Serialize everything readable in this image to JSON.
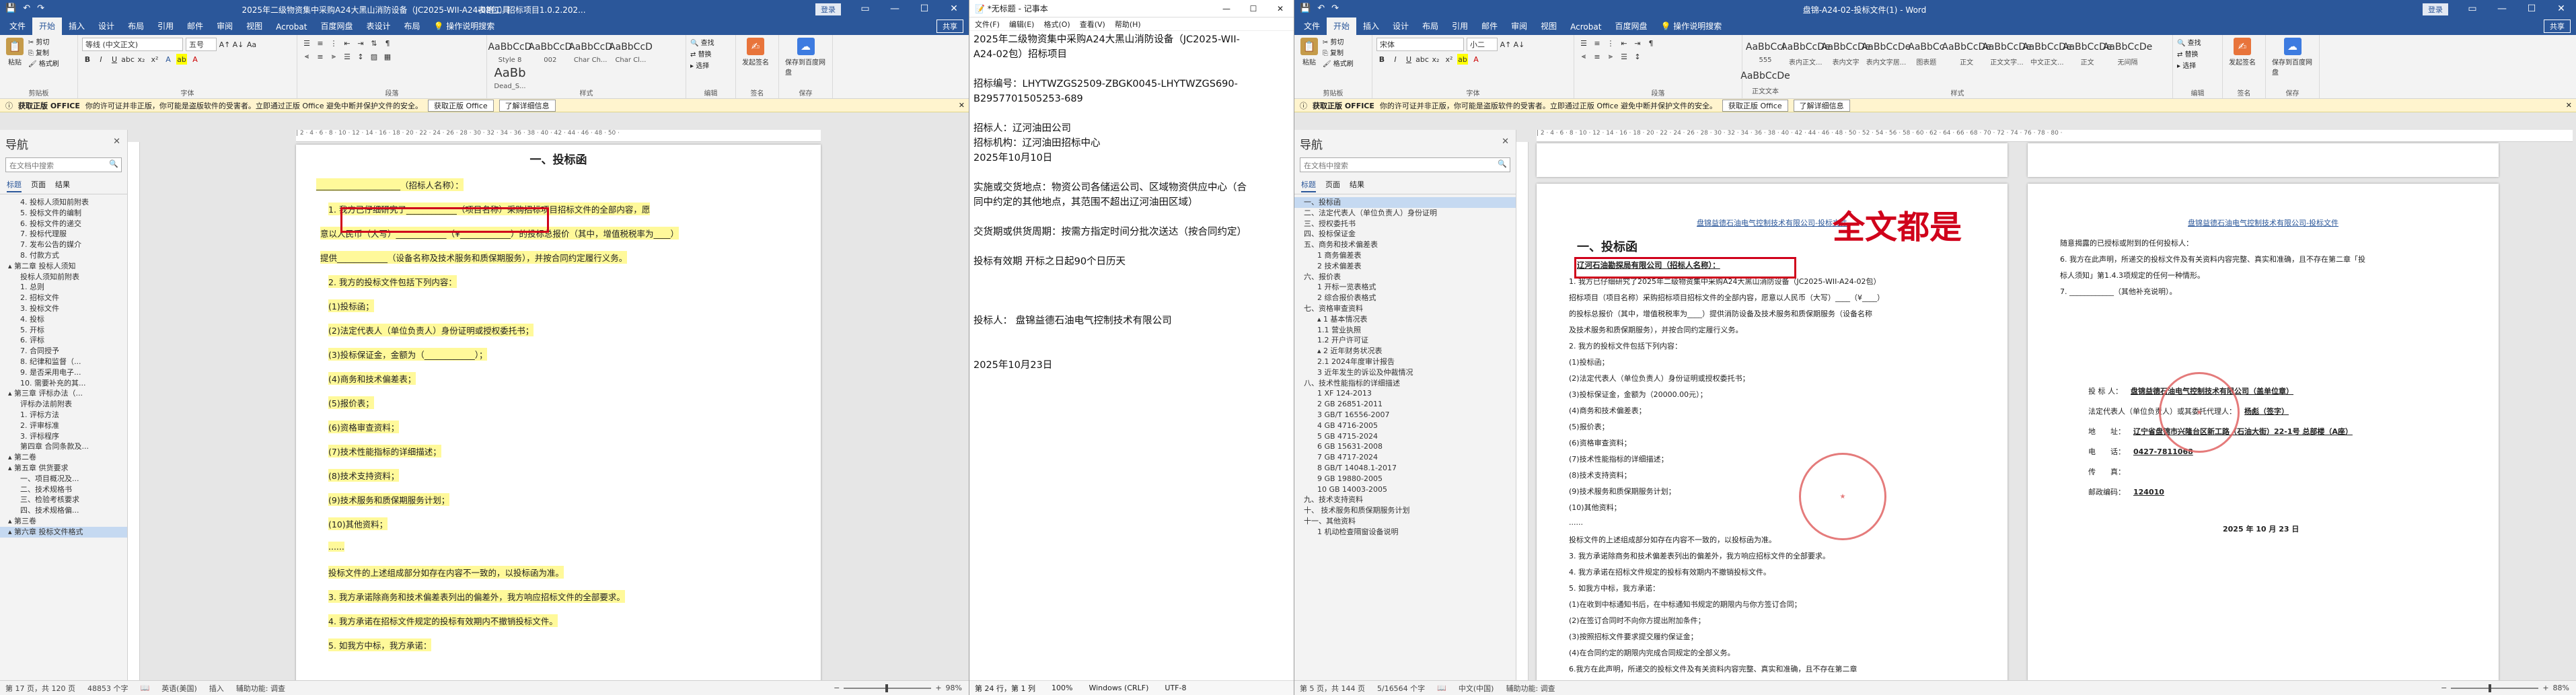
{
  "left_word": {
    "title": "2025年二级物资集中采购A24大黑山消防设备（JC2025-WII-A24-02包）招标项目1.0.2.202...",
    "context_tab": "表格工具",
    "login": "登录",
    "tabs": [
      "文件",
      "开始",
      "插入",
      "设计",
      "布局",
      "引用",
      "邮件",
      "审阅",
      "视图",
      "Acrobat",
      "百度网盘",
      "表设计",
      "布局"
    ],
    "active_tab": "开始",
    "tell_me": "操作说明搜索",
    "share": "共享",
    "ribbon": {
      "paste": "粘贴",
      "cut": "剪切",
      "copy": "复制",
      "format_painter": "格式刷",
      "clipboard": "剪贴板",
      "font_group": "字体",
      "paragraph_group": "段落",
      "styles_group": "样式",
      "edit_group": "编辑",
      "find": "查找",
      "replace": "替换",
      "select": "选择",
      "font_name": "等线 (中文正文)",
      "font_size": "五号",
      "styles": [
        {
          "preview": "AaBbCcD",
          "name": "Style 8"
        },
        {
          "preview": "AaBbCcD",
          "name": "002"
        },
        {
          "preview": "AaBbCcD",
          "name": "Char Ch..."
        },
        {
          "preview": "AaBbCcD",
          "name": "Char Cl..."
        },
        {
          "preview": "AaBb",
          "name": "Dead_S..."
        }
      ],
      "sign": "发起签名",
      "sign_group": "签名",
      "save_baidu": "保存到百度网盘",
      "save_group": "保存"
    },
    "warning": {
      "label": "获取正版 OFFICE",
      "text": "你的许可证并非正版，你可能是盗版软件的受害者。立即通过正版 Office 避免中断并保护文件的安全。",
      "btn1": "获取正版 Office",
      "btn2": "了解详细信息"
    },
    "nav": {
      "title": "导航",
      "search": "在文档中搜索",
      "tabs": [
        "标题",
        "页面",
        "结果"
      ],
      "items": [
        "4. 投标人须知前附表",
        "5. 投标文件的编制",
        "6. 投标文件的递交",
        "7. 投标代理服",
        "7. 发布公告的媒介",
        "8. 付款方式",
        "▴ 第二章 投标人须知",
        "投标人须知前附表",
        "1. 总则",
        "2. 招标文件",
        "3. 投标文件",
        "4. 投标",
        "5. 开标",
        "6. 评标",
        "7. 合同授予",
        "8. 纪律和监督（...",
        "9. 是否采用电子...",
        "10. 需要补充的其...",
        "▴ 第三章 评标办法（...",
        "评标办法前附表",
        "1. 评标方法",
        "2. 评审标准",
        "3. 评标程序",
        "第四章 合同条款及...",
        "▴ 第二卷",
        "▴ 第五章 供货要求",
        "一、项目概况及...",
        "二、技术规格书",
        "三、检验考核要求",
        "四、技术规格偏...",
        "▴ 第三卷",
        "▴ 第六章 投标文件格式"
      ]
    },
    "doc": {
      "heading": "一、投标函",
      "lines": [
        "____________________（招标人名称）：",
        "1. 我方已仔细研究了____________（项目名称）采购招标项目招标文件的全部内容，愿",
        "意以人民币（大写）____________（¥____________）的投标总报价（其中，增值税税率为____）",
        "提供____________（设备名称及技术服务和质保期服务），并按合同约定履行义务。",
        "2. 我方的投标文件包括下列内容：",
        "(1)投标函；",
        "(2)法定代表人（单位负责人）身份证明或授权委托书；",
        "(3)投标保证金，金额为（____________）；",
        "(4)商务和技术偏差表；",
        "(5)报价表；",
        "(6)资格审查资料；",
        "(7)技术性能指标的详细描述；",
        "(8)技术支持资料；",
        "(9)技术服务和质保期服务计划；",
        "(10)其他资料；",
        "......",
        "投标文件的上述组成部分如存在内容不一致的，以投标函为准。",
        "3. 我方承诺除商务和技术偏差表列出的偏差外，我方响应招标文件的全部要求。",
        "4. 我方承诺在招标文件规定的投标有效期内不撤销投标文件。",
        "5. 如我方中标，我方承诺："
      ]
    },
    "status": {
      "page": "第 17 页，共 120 页",
      "words": "48853 个字",
      "lang": "英语(美国)",
      "insert": "插入",
      "access": "辅助功能: 调查",
      "zoom": "98%"
    }
  },
  "notepad": {
    "title": "*无标题 - 记事本",
    "menu": [
      "文件(F)",
      "编辑(E)",
      "格式(O)",
      "查看(V)",
      "帮助(H)"
    ],
    "lines": [
      "2025年二级物资集中采购A24大黑山消防设备（JC2025-WII-",
      "A24-02包）招标项目",
      "",
      "招标编号：LHYTWZGS2509-ZBGK0045-LHYTWZGS690-",
      "B2957701505253-689",
      "",
      "招标人：辽河油田公司",
      "招标机构：辽河油田招标中心",
      "2025年10月10日",
      "",
      "实施或交货地点：物资公司各储运公司、区域物资供应中心（合",
      "同中约定的其他地点，其范围不超出辽河油田区域）",
      "",
      "交货期或供货周期：按需方指定时间分批次送达（按合同约定）",
      "",
      "投标有效期                  开标之日起90个日历天",
      "",
      "",
      "",
      "投标人：  盘锦益德石油电气控制技术有限公司",
      "",
      "",
      "2025年10月23日"
    ],
    "status": {
      "pos": "第 24 行，第 1 列",
      "zoom": "100%",
      "eol": "Windows (CRLF)",
      "enc": "UTF-8"
    }
  },
  "right_word": {
    "title": "盘锦-A24-02-投标文件(1) - Word",
    "login": "登录",
    "tabs": [
      "文件",
      "开始",
      "插入",
      "设计",
      "布局",
      "引用",
      "邮件",
      "审阅",
      "视图",
      "Acrobat",
      "百度网盘"
    ],
    "active_tab": "开始",
    "tell_me": "操作说明搜索",
    "share": "共享",
    "ribbon": {
      "font_name": "宋体",
      "font_size": "小二",
      "styles": [
        {
          "preview": "AaBbCcI",
          "name": "555"
        },
        {
          "preview": "AaBbCcDe",
          "name": "表内正文..."
        },
        {
          "preview": "AaBbCcDe",
          "name": "表内文字"
        },
        {
          "preview": "AaBbCcDe",
          "name": "表内文字居..."
        },
        {
          "preview": "AaBbCc",
          "name": "图表题"
        },
        {
          "preview": "AaBbCcDe",
          "name": "正文"
        },
        {
          "preview": "AaBbCcDe",
          "name": "正文文字..."
        },
        {
          "preview": "AaBbCcDe",
          "name": "中文正文..."
        },
        {
          "preview": "AaBbCcDe",
          "name": "正文"
        },
        {
          "preview": "AaBbCcDe",
          "name": "无间隔"
        },
        {
          "preview": "AaBbCcDe",
          "name": "正文文本"
        }
      ]
    },
    "nav": {
      "items": [
        "一、投标函",
        "二、法定代表人（单位负责人）身份证明",
        "三、授权委托书",
        "四、投标保证金",
        "五、商务和技术偏差表",
        "1 商务偏差表",
        "2 技术偏差表",
        "六、报价表",
        "1 开标一览表格式",
        "2 综合报价表格式",
        "七、资格审查资料",
        "▴ 1 基本情况表",
        "1.1 营业执照",
        "1.2 开户许可证",
        "▴ 2 近年财务状况表",
        "2.1 2024年度审计报告",
        "3 近年发生的诉讼及仲裁情况",
        "八、技术性能指标的详细描述",
        "1 XF 124-2013",
        "2 GB 26851-2011",
        "3 GB/T 16556-2007",
        "4 GB 4716-2005",
        "5 GB 4715-2024",
        "6 GB 15631-2008",
        "7 GB 4717-2024",
        "8 GB/T 14048.1-2017",
        "9 GB 19880-2005",
        "10 GB 14003-2005",
        "九、技术支持资料",
        "十、 技术服务和质保期服务计划",
        "十一、其他资料",
        "1 机动检查隔窗设备说明"
      ]
    },
    "annotation": "全文都是",
    "doc": {
      "header": "盘锦益德石油电气控制技术有限公司-投标文件",
      "heading": "一、投标函",
      "tenderer": "辽河石油勘探局有限公司（招标人名称）：",
      "lines": [
        "1. 我方已仔细研究了2025年二级物资集中采购A24大黑山消防设备（JC2025-WII-A24-02包）",
        "招标项目（项目名称）采购招标项目招标文件的全部内容，愿意以人民币（大写）____（¥____）",
        "的投标总报价（其中，增值税税率为____）提供消防设备及技术服务和质保期服务（设备名称",
        "及技术服务和质保期服务），并按合同约定履行义务。",
        "2. 我方的投标文件包括下列内容：",
        "(1)投标函；",
        "(2)法定代表人（单位负责人）身份证明或授权委托书；",
        "(3)投标保证金，金额为（20000.00元）；",
        "(4)商务和技术偏差表；",
        "(5)报价表；",
        "(6)资格审查资料；",
        "(7)技术性能指标的详细描述；",
        "(8)技术支持资料；",
        "(9)技术服务和质保期服务计划；",
        "(10)其他资料；",
        "......",
        "投标文件的上述组成部分如存在内容不一致的，以投标函为准。",
        "3. 我方承诺除商务和技术偏差表列出的偏差外，我方响应招标文件的全部要求。",
        "4. 我方承诺在招标文件规定的投标有效期内不撤销投标文件。",
        "5. 如我方中标，我方承诺：",
        "(1)在收到中标通知书后，在中标通知书规定的期限内与你方签订合同；",
        "(2)在签订合同时不向你方提出附加条件；",
        "(3)按照招标文件要求提交履约保证金；",
        "(4)在合同约定的期限内完成合同规定的全部义务。",
        "6.我方在此声明，所递交的投标文件及有关资料内容完整、真实和准确，且不存在第二章"
      ],
      "page2_lines": [
        "随意揭露的已授标或附到的任何投标人：",
        "6. 我方在此声明，所递交的投标文件及有关资料内容完整、真实和准确，且不存在第二章「投",
        "标人须知」第1.4.3项规定的任何一种情形。",
        "7. ____________（其他补充说明）。"
      ],
      "signature": [
        {
          "label": "投 标 人：",
          "value": "盘锦益德石油电气控制技术有限公司（盖单位章）"
        },
        {
          "label": "法定代表人（单位负责人）或其委托代理人：",
          "value": "杨彪（签字）"
        },
        {
          "label": "地　　址：",
          "value": "辽宁省盘锦市兴隆台区新工路（石油大街）22-1号 总部楼（A座）"
        },
        {
          "label": "电　　话：",
          "value": "0427-7811068"
        },
        {
          "label": "传　　真：",
          "value": ""
        },
        {
          "label": "邮政编码：",
          "value": "124010"
        }
      ],
      "date": "2025 年 10 月 23 日"
    },
    "status": {
      "page": "第 5 页，共 144 页",
      "words": "5/16564 个字",
      "lang": "中文(中国)",
      "access": "辅助功能: 调查",
      "zoom": "88%"
    }
  },
  "colors": {
    "word_blue": "#2b579a",
    "annotation_red": "#d0021b",
    "highlight": "#fff99a"
  }
}
